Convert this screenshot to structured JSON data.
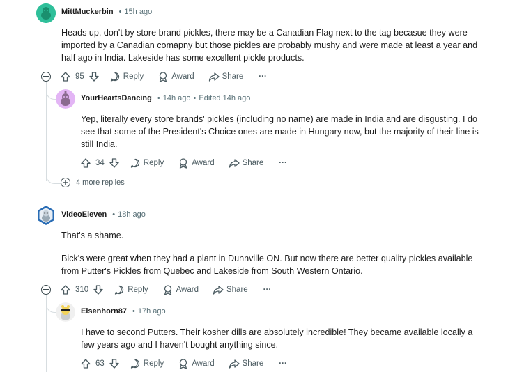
{
  "comments": [
    {
      "user": "MittMuckerbin",
      "time": "15h ago",
      "edited": "",
      "paragraphs": [
        "Heads up, don't by store brand pickles, there may be a Canadian Flag next to the tag becasue they were imported by a Canadian comapny but those pickles are probably mushy and were made at least a year and half ago in India. Lakeside has some excellent pickle products."
      ],
      "score": "95",
      "avatar_icon": "snoo-avatar-green",
      "accent": "#2fbf9a"
    },
    {
      "user": "YourHeartsDancing",
      "time": "14h ago",
      "edited": "Edited 14h ago",
      "paragraphs": [
        "Yep,  literally every store brands' pickles (including no name) are made in India and are disgusting. I do see that some of the President's Choice ones are made in Hungary now, but the majority of their line is still India."
      ],
      "score": "34",
      "avatar_icon": "snoo-avatar-purple",
      "accent": "#d9a6f0"
    },
    {
      "user": "VideoEleven",
      "time": "18h ago",
      "edited": "",
      "paragraphs": [
        "That's a shame.",
        "Bick's were great when they had a plant in Dunnville ON. But now there are better quality pickles available from Putter's Pickles from Quebec and Lakeside from South Western Ontario."
      ],
      "score": "310",
      "avatar_icon": "snoo-avatar-blue-hex",
      "accent": "#2a6db5"
    },
    {
      "user": "Eisenhorn87",
      "time": "17h ago",
      "edited": "",
      "paragraphs": [
        "I have to second Putters. Their kosher dills are absolutely incredible! They became available locally a few years ago and I haven't bought anything since."
      ],
      "score": "63",
      "avatar_icon": "snoo-avatar-sunglasses",
      "accent": "#f2d35a"
    }
  ],
  "actions": {
    "reply": "Reply",
    "award": "Award",
    "share": "Share",
    "overflow": "···"
  },
  "more_replies": "4 more replies",
  "icons": [
    "upvote-icon",
    "downvote-icon",
    "reply-icon",
    "award-icon",
    "share-icon",
    "overflow-icon",
    "collapse-icon",
    "expand-icon"
  ]
}
